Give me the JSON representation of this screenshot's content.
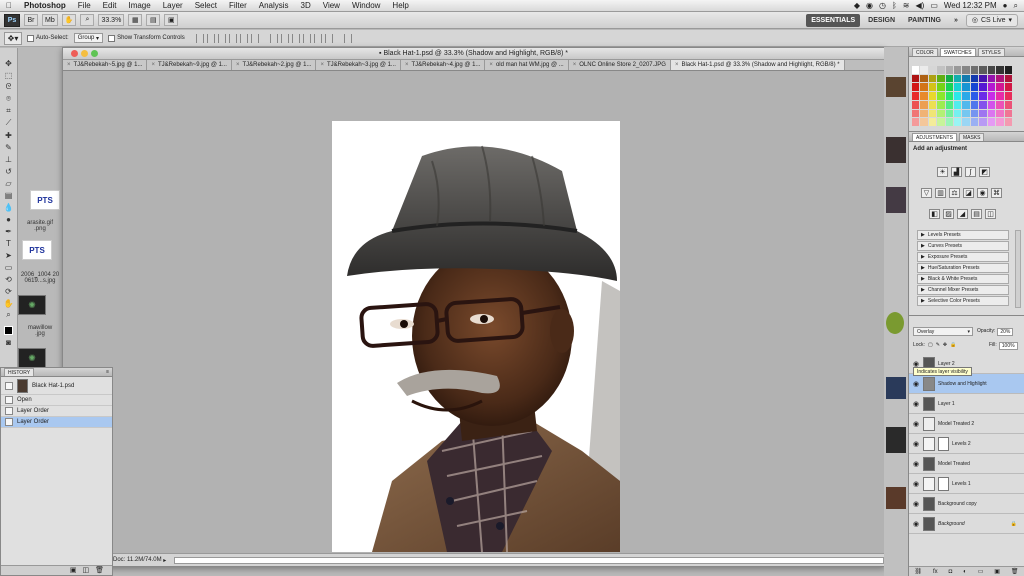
{
  "menubar": {
    "app": "Photoshop",
    "items": [
      "File",
      "Edit",
      "Image",
      "Layer",
      "Select",
      "Filter",
      "Analysis",
      "3D",
      "View",
      "Window",
      "Help"
    ],
    "clock": "Wed 12:32 PM"
  },
  "appbar": {
    "logo": "Ps",
    "zoom": "33.3%",
    "workspaces": [
      "ESSENTIALS",
      "DESIGN",
      "PAINTING"
    ],
    "more": "»",
    "cslive": "CS Live"
  },
  "options": {
    "auto_select_label": "Auto-Select:",
    "auto_select_value": "Group",
    "show_transform_label": "Show Transform Controls"
  },
  "document": {
    "title": "Black Hat-1.psd @ 33.3% (Shadow and Highlight, RGB/8) *",
    "tabs": [
      "TJ&Rebekah~5.jpg @ 1...",
      "TJ&Rebekah~9.jpg @ 1...",
      "TJ&Rebekah~2.jpg @ 1...",
      "TJ&Rebekah~3.jpg @ 1...",
      "TJ&Rebekah~4.jpg @ 1...",
      "old man hat WM.jpg @ ...",
      "OLNC Online Store 2_0207.JPG",
      "Black Hat-1.psd @ 33.3% (Shadow and Highlight, RGB/8) *"
    ],
    "doc_status": "Doc: 11.2M/74.0M"
  },
  "desktop": {
    "icons": [
      ".gif",
      "PTS",
      "arasite.gif\n.png",
      "PTS",
      "2006_1004 20\n0619...s.jpg",
      "mawillow\n.jpg"
    ]
  },
  "history": {
    "title": "HISTORY",
    "snapshot": "Black Hat-1.psd",
    "steps": [
      "Open",
      "Layer Order",
      "Layer Order"
    ]
  },
  "swatches_panel": {
    "tabs": [
      "COLOR",
      "SWATCHES",
      "STYLES"
    ]
  },
  "adjustments": {
    "tabs": [
      "ADJUSTMENTS",
      "MASKS"
    ],
    "heading": "Add an adjustment",
    "presets": [
      "Levels Presets",
      "Curves Presets",
      "Exposure Presets",
      "Hue/Saturation Presets",
      "Black & White Presets",
      "Channel Mixer Presets",
      "Selective Color Presets"
    ]
  },
  "layers": {
    "blend_mode": "Overlay",
    "opacity_label": "Opacity:",
    "opacity": "20%",
    "lock_label": "Lock:",
    "fill_label": "Fill:",
    "fill": "100%",
    "tooltip": "Indicates layer visibility",
    "rows": [
      "Layer 2",
      "Shadow and Highlight",
      "Layer 1",
      "Model Treated 2",
      "Levels 2",
      "Model Treated",
      "Levels 1",
      "Background copy",
      "Background"
    ]
  }
}
